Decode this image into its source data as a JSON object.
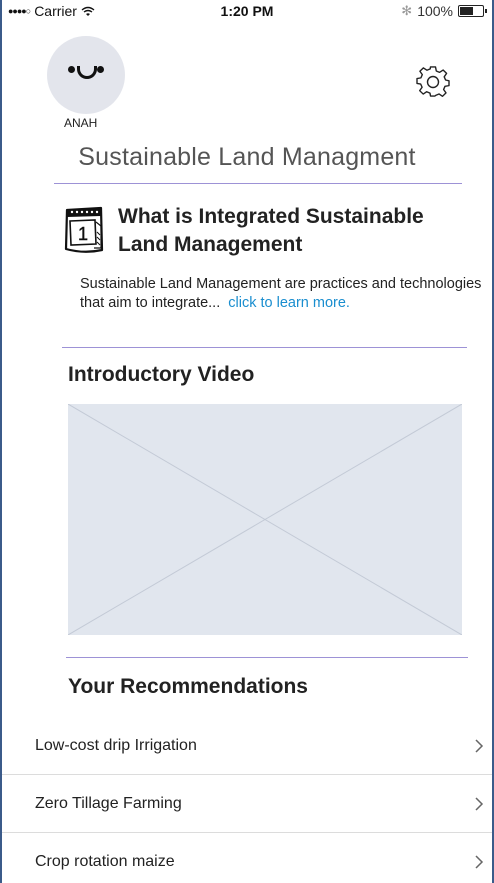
{
  "status_bar": {
    "signal": "●●●●○",
    "carrier": "Carrier",
    "time": "1:20 PM",
    "battery_text": "100%",
    "battery_level": 0.6
  },
  "profile": {
    "username": "ANAH"
  },
  "header": {
    "title": "Sustainable Land Managment"
  },
  "intro_section": {
    "heading": "What is Integrated Sustainable Land Management",
    "text": "Sustainable Land Management are practices and technologies that aim to integrate...",
    "link_text": "click to learn more.",
    "calendar_number": "1"
  },
  "video_section": {
    "heading": "Introductory Video"
  },
  "recommendations": {
    "heading": "Your Recommendations",
    "items": [
      {
        "label": "Low-cost drip Irrigation"
      },
      {
        "label": "Zero Tillage Farming"
      },
      {
        "label": "Crop rotation maize"
      }
    ]
  },
  "colors": {
    "divider": "#9d92d6",
    "link": "#1a8ecf",
    "placeholder": "#e1e6ee",
    "frame": "#3b5b8a"
  }
}
